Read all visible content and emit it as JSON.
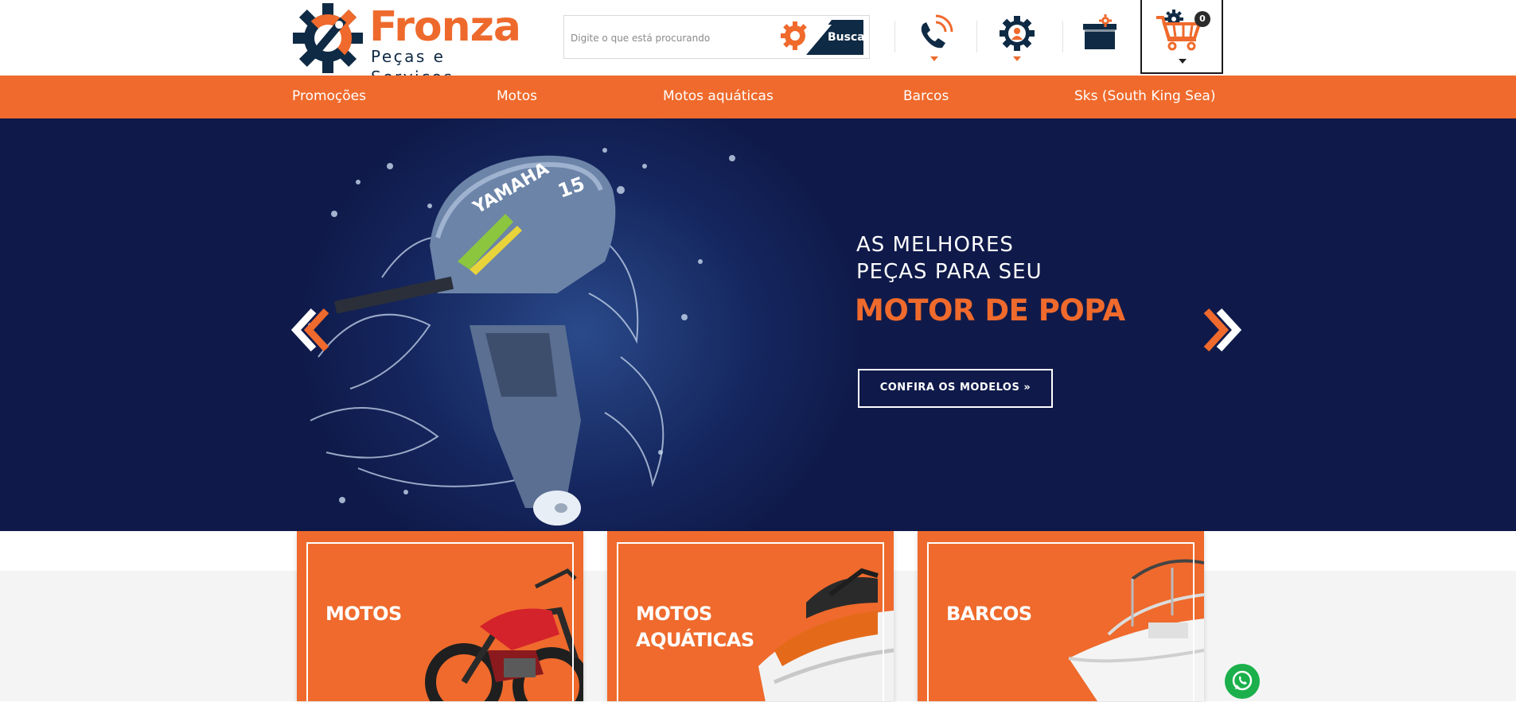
{
  "brand": {
    "name": "Fronza",
    "tagline": "Peças e Serviços",
    "colors": {
      "orange": "#ef6a2c",
      "navy": "#0f2a44",
      "hero_bg": "#0f1a4a",
      "whatsapp": "#1bb04b"
    }
  },
  "search": {
    "placeholder": "Digite o que está procurando",
    "button_label": "Busca"
  },
  "header_icons": [
    "phone-icon",
    "user-account-icon",
    "orders-box-icon",
    "shopping-cart-icon"
  ],
  "cart": {
    "count": "0"
  },
  "nav": {
    "items": [
      "Promoções",
      "Motos",
      "Motos aquáticas",
      "Barcos",
      "Sks (South King Sea)"
    ]
  },
  "hero": {
    "line1": "AS MELHORES",
    "line2": "PEÇAS PARA SEU",
    "line3": "MOTOR DE POPA",
    "cta": "CONFIRA OS MODELOS »",
    "motor_brand": "YAMAHA",
    "motor_hp": "15"
  },
  "categories": [
    {
      "line1": "MOTOS",
      "line2": ""
    },
    {
      "line1": "MOTOS",
      "line2": "AQUÁTICAS"
    },
    {
      "line1": "BARCOS",
      "line2": ""
    }
  ]
}
